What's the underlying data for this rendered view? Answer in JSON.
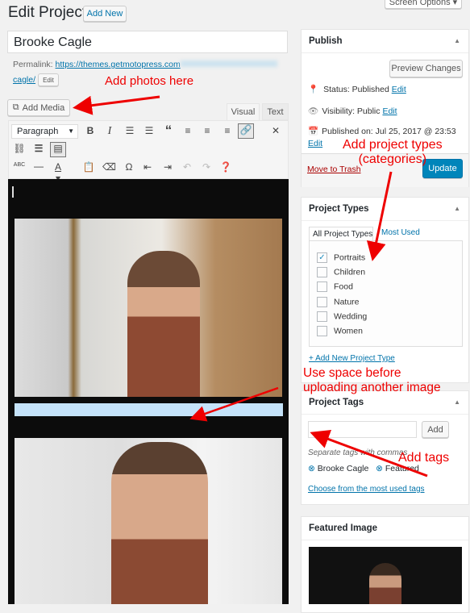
{
  "header": {
    "title": "Edit Project",
    "add_new": "Add New",
    "screen_options": "Screen Options"
  },
  "post": {
    "title": "Brooke Cagle",
    "permalink_label": "Permalink:",
    "permalink_url": "https://themes.getmotopress.com",
    "permalink_end": "cagle/",
    "edit": "Edit"
  },
  "editor": {
    "add_media": "Add Media",
    "tab_visual": "Visual",
    "tab_text": "Text",
    "format_select": "Paragraph"
  },
  "publish": {
    "title": "Publish",
    "preview": "Preview Changes",
    "status": "Status: Published",
    "visibility": "Visibility: Public",
    "published_on": "Published on: Jul 25, 2017 @ 23:53",
    "edit": "Edit",
    "trash": "Move to Trash",
    "update": "Update"
  },
  "project_types": {
    "title": "Project Types",
    "tab_all": "All Project Types",
    "tab_most": "Most Used",
    "items": [
      {
        "label": "Portraits",
        "checked": true
      },
      {
        "label": "Children",
        "checked": false
      },
      {
        "label": "Food",
        "checked": false
      },
      {
        "label": "Nature",
        "checked": false
      },
      {
        "label": "Wedding",
        "checked": false
      },
      {
        "label": "Women",
        "checked": false
      }
    ],
    "add_new": "+ Add New Project Type"
  },
  "project_tags": {
    "title": "Project Tags",
    "add": "Add",
    "help": "Separate tags with commas",
    "tags": [
      "Brooke Cagle",
      "Featured"
    ],
    "choose": "Choose from the most used tags"
  },
  "featured_image": {
    "title": "Featured Image"
  },
  "annotations": {
    "photos": "Add photos here",
    "types_1": "Add project types",
    "types_2": "(categories)",
    "space_1": "Use space before",
    "space_2": "uploading another image",
    "tags": "Add tags"
  },
  "colors": {
    "annotation": "#ee0000",
    "primary": "#0085ba",
    "selection": "#c5e3fa"
  }
}
